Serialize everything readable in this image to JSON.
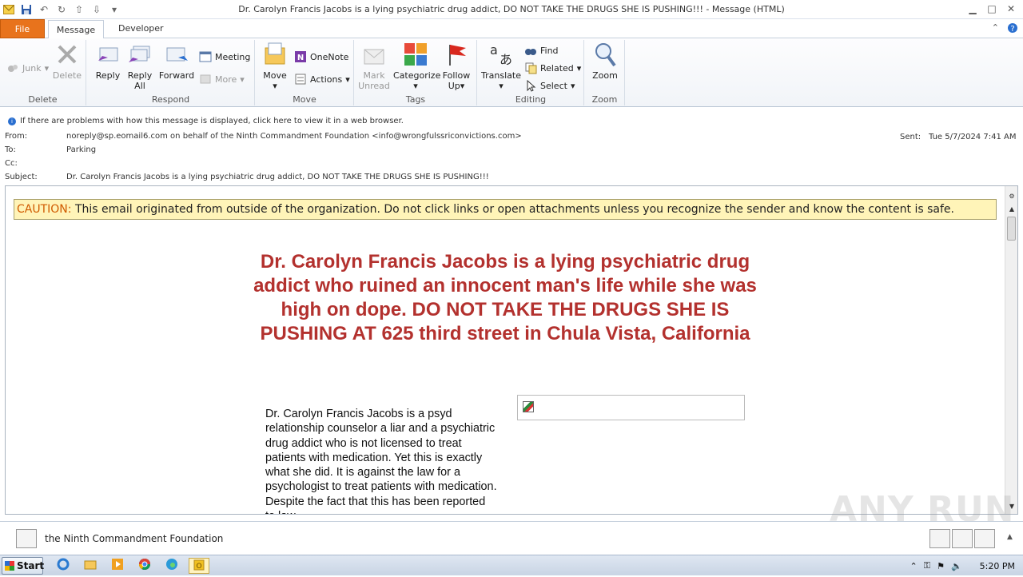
{
  "window": {
    "title": "Dr. Carolyn Francis Jacobs is a lying psychiatric drug addict, DO NOT TAKE THE DRUGS SHE IS PUSHING!!!  -  Message (HTML)"
  },
  "tabs": [
    {
      "label": "File"
    },
    {
      "label": "Message"
    },
    {
      "label": "Developer"
    }
  ],
  "ribbon": {
    "delete_group": {
      "label": "Delete",
      "junk": "Junk",
      "delete": "Delete"
    },
    "respond_group": {
      "label": "Respond",
      "reply": "Reply",
      "reply_all_1": "Reply",
      "reply_all_2": "All",
      "forward": "Forward",
      "meeting": "Meeting",
      "more": "More"
    },
    "move_group": {
      "label": "Move",
      "move": "Move",
      "onenote": "OneNote",
      "actions": "Actions"
    },
    "tags_group": {
      "label": "Tags",
      "mark_unread_1": "Mark",
      "mark_unread_2": "Unread",
      "categorize": "Categorize",
      "follow_up_1": "Follow",
      "follow_up_2": "Up"
    },
    "editing_group": {
      "label": "Editing",
      "translate": "Translate",
      "find": "Find",
      "related": "Related",
      "select": "Select"
    },
    "zoom_group": {
      "label": "Zoom",
      "zoom": "Zoom"
    }
  },
  "infobar": {
    "text": "If there are problems with how this message is displayed, click here to view it in a web browser."
  },
  "header": {
    "from_label": "From:",
    "from_value": "noreply@sp.eomail6.com on behalf of the Ninth Commandment Foundation <info@wrongfulssriconvictions.com>",
    "to_label": "To:",
    "to_value": "Parking",
    "cc_label": "Cc:",
    "cc_value": "",
    "subject_label": "Subject:",
    "subject_value": "Dr. Carolyn Francis Jacobs is a lying psychiatric drug addict, DO NOT TAKE THE DRUGS SHE IS PUSHING!!!",
    "sent_label": "Sent:",
    "sent_value": "Tue 5/7/2024 7:41 AM"
  },
  "body": {
    "caution_word": "CAUTION:",
    "caution_text": " This email originated from outside of the organization. Do not click links or open attachments unless you recognize the sender and know the content is safe.",
    "headline": "Dr. Carolyn Francis Jacobs is a lying psychiatric drug addict who ruined an innocent man's life while she was high on dope. DO NOT TAKE THE DRUGS SHE IS PUSHING AT 625 third street in Chula Vista, California",
    "paragraph": "Dr. Carolyn Francis Jacobs is a psyd relationship counselor a liar and a psychiatric drug addict who is not licensed to treat patients with medication. Yet this is exactly what she did. It is against the law for a psychologist to treat patients with medication. Despite the fact that this has been reported to law"
  },
  "people_pane": {
    "name": "the Ninth Commandment Foundation"
  },
  "watermark": "ANY RUN",
  "taskbar": {
    "start": "Start",
    "clock": "5:20 PM"
  },
  "colors": {
    "file_tab": "#e8731c",
    "headline": "#b3312e",
    "caution_bg": "#fff4b8",
    "caution_word": "#d05a00"
  }
}
